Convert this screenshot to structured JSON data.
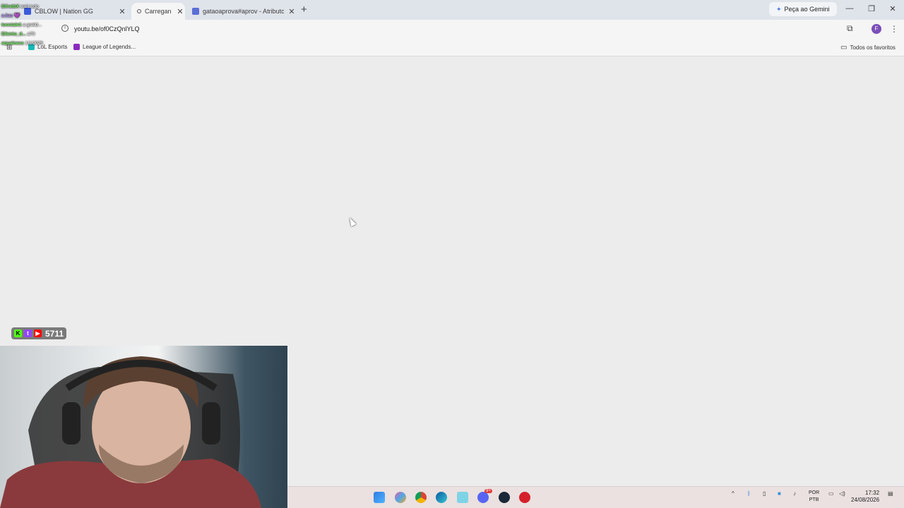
{
  "browser": {
    "tabs": [
      {
        "title": "CBLOW | Nation GG",
        "active": false,
        "close": "✕"
      },
      {
        "title": "Carregan",
        "active": true,
        "close": "✕"
      },
      {
        "title": "gataoaprova#aprov - Atributos",
        "active": false,
        "close": "✕"
      }
    ],
    "new_tab": "+",
    "gemini_label": "Peça ao Gemini",
    "window_controls": {
      "minimize": "—",
      "restore": "❐",
      "close": "✕"
    },
    "address": "youtu.be/of0CzQnlYLQ",
    "profile_initial": "F",
    "bookmarks": [
      {
        "label": "LoL Esports"
      },
      {
        "label": "League of Legends..."
      }
    ],
    "all_bookmarks_label": "Todos os favoritos"
  },
  "stream_overlay": {
    "viewer_count": "5711",
    "chat": [
      {
        "user": "ElfratbX",
        "text": "wait tudo"
      },
      {
        "user": "a.lias",
        "text": "💜"
      },
      {
        "user": "toostale1",
        "text": "a grelid..."
      },
      {
        "user": "Ellentu_d...",
        "text": "a70"
      },
      {
        "user": "aqualness",
        "text": "1/1/2025"
      }
    ]
  },
  "taskbar": {
    "language_top": "POR",
    "language_bottom": "PTB",
    "time": "17:32",
    "date": "24/08/2026",
    "discord_badge": "9+"
  },
  "colors": {
    "titlebar": "#dfe3ea",
    "toolbar": "#f5f5f5",
    "page_bg": "#ececec",
    "taskbar": "#eae1e0",
    "accent_profile": "#7b4fb8"
  }
}
